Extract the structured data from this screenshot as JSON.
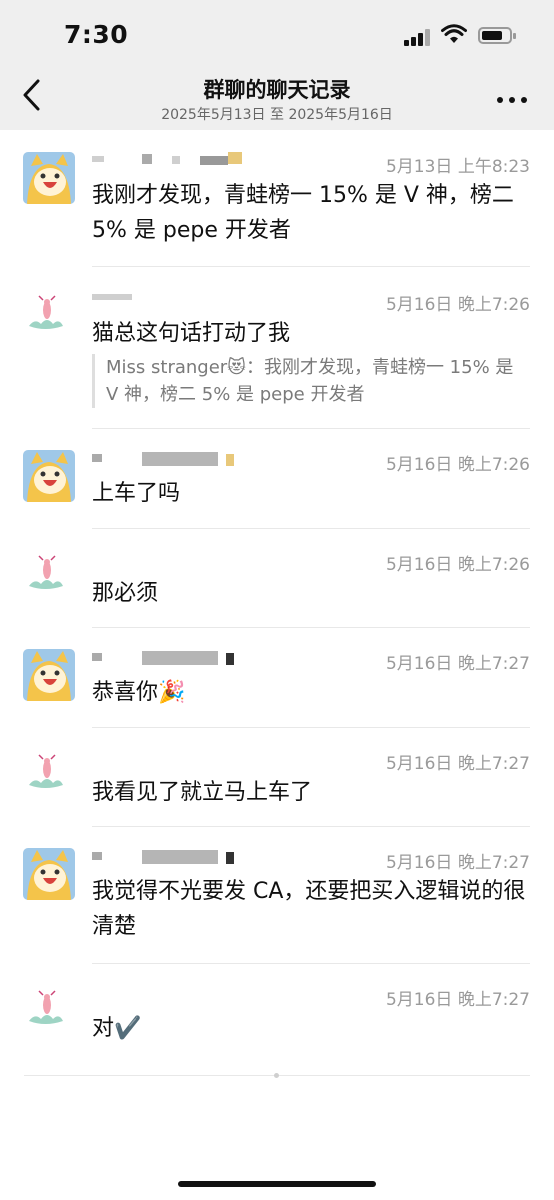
{
  "status_bar": {
    "time": "7:30"
  },
  "header": {
    "title": "群聊的聊天记录",
    "subtitle": "2025年5月13日 至 2025年5月16日"
  },
  "messages": [
    {
      "avatar": "cartoon-cat-avatar",
      "timestamp": "5月13日 上午8:23",
      "text": "我刚才发现，青蛙榜一 15% 是 V 神，榜二 5% 是 pepe 开发者"
    },
    {
      "avatar": "shrimp-cloud-avatar",
      "timestamp": "5月16日 晚上7:26",
      "text": "猫总这句话打动了我",
      "quote": "Miss stranger😻：我刚才发现，青蛙榜一 15% 是 V 神，榜二 5% 是 pepe 开发者"
    },
    {
      "avatar": "cartoon-cat-avatar",
      "timestamp": "5月16日 晚上7:26",
      "text": "上车了吗"
    },
    {
      "avatar": "shrimp-cloud-avatar",
      "timestamp": "5月16日 晚上7:26",
      "text": "那必须"
    },
    {
      "avatar": "cartoon-cat-avatar",
      "timestamp": "5月16日 晚上7:27",
      "text": "恭喜你🎉"
    },
    {
      "avatar": "shrimp-cloud-avatar",
      "timestamp": "5月16日 晚上7:27",
      "text": "我看见了就立马上车了"
    },
    {
      "avatar": "cartoon-cat-avatar",
      "timestamp": "5月16日 晚上7:27",
      "text": "我觉得不光要发 CA，还要把买入逻辑说的很清楚"
    },
    {
      "avatar": "shrimp-cloud-avatar",
      "timestamp": "5月16日 晚上7:27",
      "text": "对✔️"
    }
  ],
  "icons": {
    "back": "chevron-left-icon",
    "more": "more-dots-icon",
    "signal": "signal-icon",
    "wifi": "wifi-icon",
    "battery": "battery-icon"
  }
}
